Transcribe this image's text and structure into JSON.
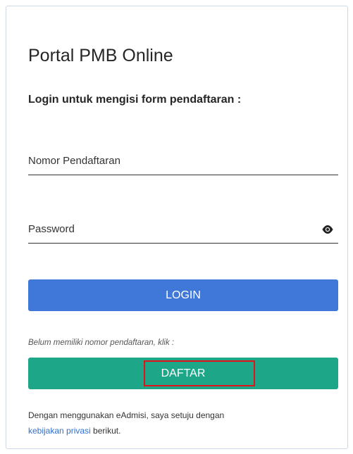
{
  "title": "Portal PMB Online",
  "subtitle": "Login untuk mengisi form pendaftaran :",
  "fields": {
    "nomor_placeholder": "Nomor Pendaftaran",
    "password_placeholder": "Password"
  },
  "icons": {
    "password_toggle": "eye-icon"
  },
  "buttons": {
    "login": "LOGIN",
    "daftar": "DAFTAR"
  },
  "hint": "Belum memiliki nomor pendaftaran, klik :",
  "terms": {
    "line1": "Dengan menggunakan eAdmisi, saya setuju dengan",
    "link": "kebijakan privasi",
    "after": " berikut."
  },
  "colors": {
    "login_button": "#3f78d8",
    "daftar_button": "#1ea689",
    "highlight_box": "#e0131b",
    "link": "#2f6fd0"
  }
}
